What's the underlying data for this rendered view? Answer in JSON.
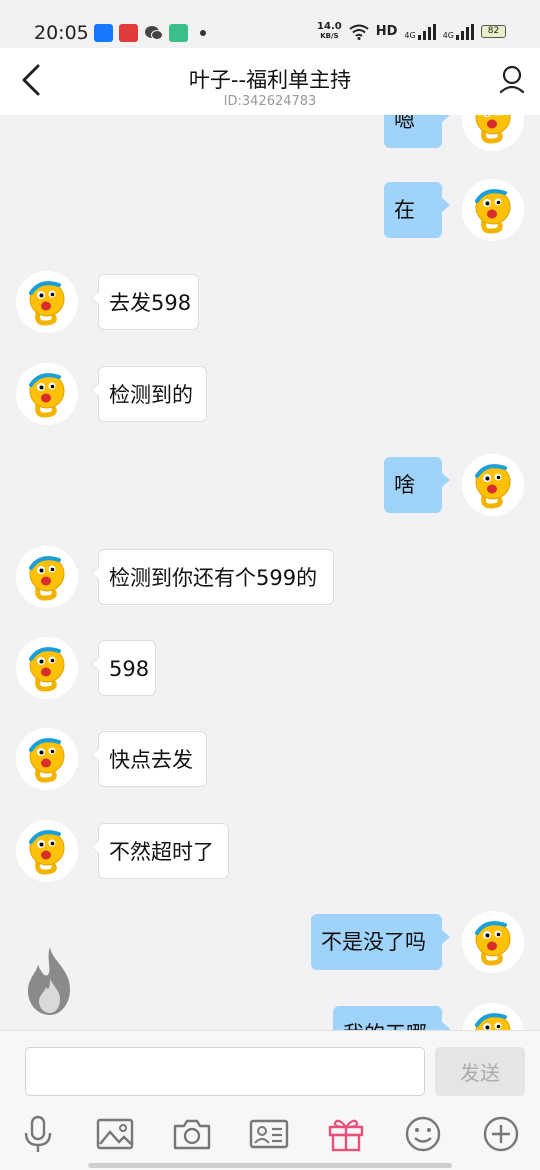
{
  "status_bar": {
    "time": "20:05",
    "net_speed_value": "14.0",
    "net_speed_unit": "KB/S",
    "hd_label": "HD",
    "sig1": "4G",
    "sig2": "4G",
    "battery": "82"
  },
  "header": {
    "title": "叶子--福利单主持",
    "subtitle": "ID:342624783"
  },
  "messages": [
    {
      "side": "out",
      "text": "嗯"
    },
    {
      "side": "out",
      "text": "在"
    },
    {
      "side": "in",
      "text": "去发598"
    },
    {
      "side": "in",
      "text": "检测到的"
    },
    {
      "side": "out",
      "text": "啥"
    },
    {
      "side": "in",
      "text": "检测到你还有个599的"
    },
    {
      "side": "in",
      "text": "598"
    },
    {
      "side": "in",
      "text": "快点去发"
    },
    {
      "side": "in",
      "text": "不然超时了"
    },
    {
      "side": "out",
      "text": "不是没了吗"
    },
    {
      "side": "out",
      "text": "我的天哪"
    }
  ],
  "input": {
    "placeholder": "",
    "send_label": "发送"
  },
  "toolbar_icons": [
    "microphone-icon",
    "image-icon",
    "camera-icon",
    "contact-card-icon",
    "gift-icon",
    "emoji-icon",
    "plus-icon"
  ],
  "colors": {
    "outgoing_bubble": "#9fd3f9",
    "incoming_bubble": "#ffffff",
    "gift_accent": "#e8507a"
  }
}
